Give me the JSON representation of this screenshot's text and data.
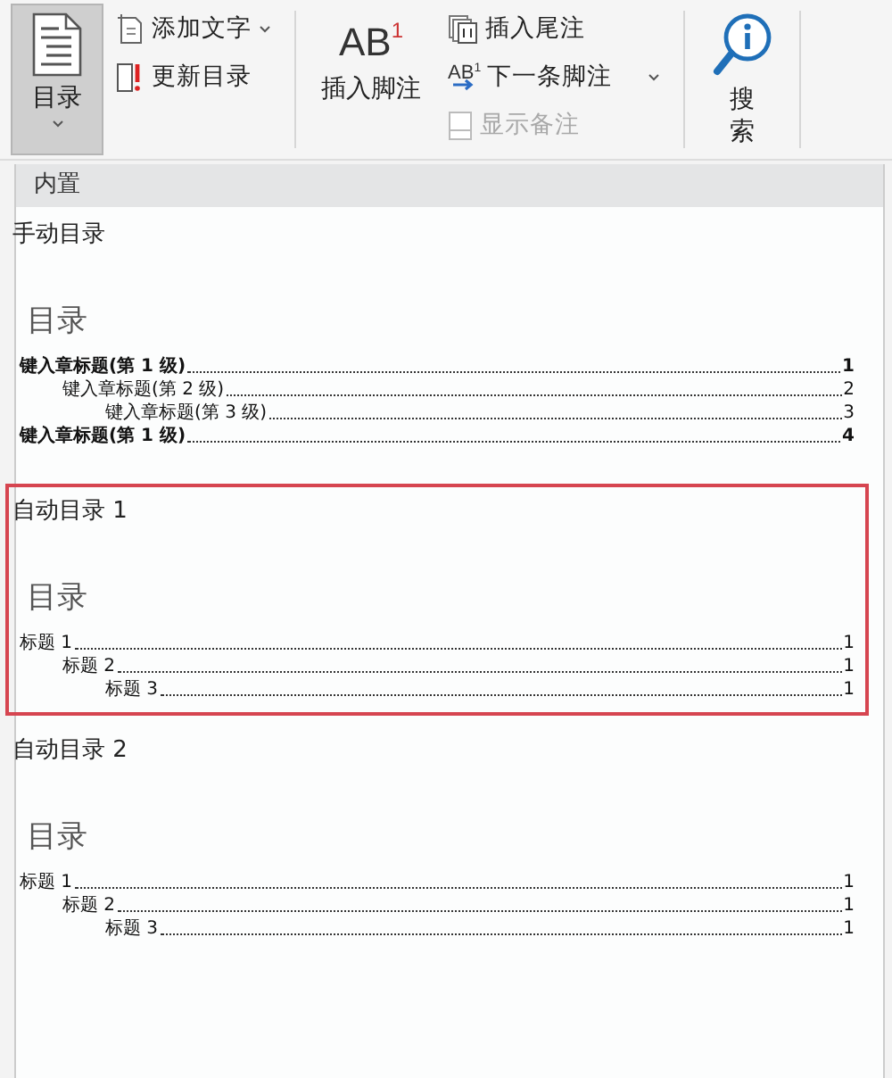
{
  "ribbon": {
    "toc_button": {
      "label": "目录",
      "selected": true
    },
    "add_text": {
      "label": "添加文字"
    },
    "update_toc": {
      "label": "更新目录"
    },
    "insert_footnote": {
      "label": "插入脚注",
      "icon_text": "AB",
      "icon_mark": "1"
    },
    "insert_endnote": {
      "label": "插入尾注"
    },
    "next_footnote": {
      "label": "下一条脚注",
      "icon_text": "AB",
      "icon_mark": "1"
    },
    "show_notes": {
      "label": "显示备注",
      "disabled": true
    },
    "search": {
      "label": "搜索"
    }
  },
  "gallery": {
    "header": "内置",
    "sections": [
      {
        "kind": "manual",
        "title": "手动目录",
        "selected": false,
        "heading": "目录",
        "entries": [
          {
            "text": "键入章标题(第 1 级)",
            "page": "1",
            "children": [
              {
                "text": "键入章标题(第 2 级)",
                "page": "2",
                "children": [
                  {
                    "text": "键入章标题(第 3 级)",
                    "page": "3"
                  }
                ]
              }
            ]
          },
          {
            "text": "键入章标题(第 1 级)",
            "page": "4"
          }
        ]
      },
      {
        "kind": "auto",
        "title": "自动目录 1",
        "selected": true,
        "heading": "目录",
        "entries": [
          {
            "text": "标题 1",
            "page": "1",
            "children": [
              {
                "text": "标题 2",
                "page": "1",
                "children": [
                  {
                    "text": "标题 3",
                    "page": "1"
                  }
                ]
              }
            ]
          }
        ]
      },
      {
        "kind": "auto",
        "title": "自动目录 2",
        "selected": false,
        "heading": "目录",
        "entries": [
          {
            "text": "标题 1",
            "page": "1",
            "children": [
              {
                "text": "标题 2",
                "page": "1",
                "children": [
                  {
                    "text": "标题 3",
                    "page": "1"
                  }
                ]
              }
            ]
          }
        ]
      }
    ]
  }
}
